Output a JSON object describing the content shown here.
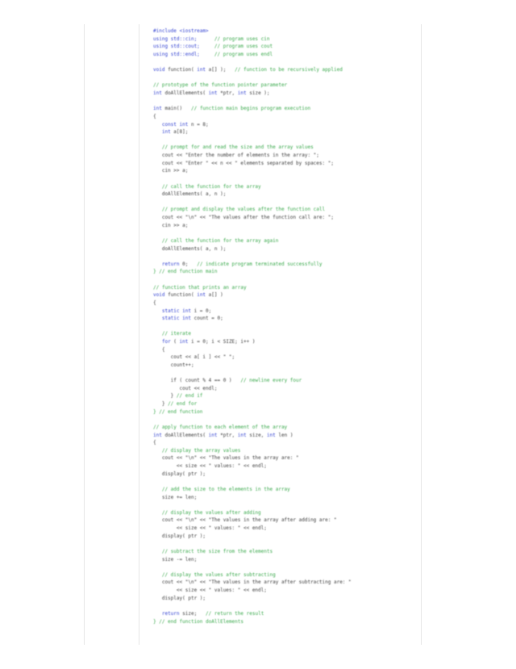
{
  "page": {
    "lines": [
      [
        {
          "t": "#include <iostream>",
          "c": "kw"
        }
      ],
      [
        {
          "t": "using std::cin;",
          "c": "kw"
        },
        {
          "t": "      // program uses cin",
          "c": "cm"
        }
      ],
      [
        {
          "t": "using std::cout;",
          "c": "kw"
        },
        {
          "t": "     // program uses cout",
          "c": "cm"
        }
      ],
      [
        {
          "t": "using std::endl;",
          "c": "kw"
        },
        {
          "t": "     // program uses endl",
          "c": "cm"
        }
      ],
      [
        {
          "t": "",
          "c": "tx"
        }
      ],
      [
        {
          "t": "void",
          "c": "kw"
        },
        {
          "t": " function( ",
          "c": "tx"
        },
        {
          "t": "int",
          "c": "kw"
        },
        {
          "t": " a[] );",
          "c": "tx"
        },
        {
          "t": "   // function to be recursively applied",
          "c": "cm"
        }
      ],
      [
        {
          "t": "",
          "c": "tx"
        }
      ],
      [
        {
          "t": "// prototype of the function pointer parameter",
          "c": "cm"
        }
      ],
      [
        {
          "t": "int",
          "c": "kw"
        },
        {
          "t": " doAllElements( ",
          "c": "tx"
        },
        {
          "t": "int",
          "c": "kw"
        },
        {
          "t": " *ptr, ",
          "c": "tx"
        },
        {
          "t": "int",
          "c": "kw"
        },
        {
          "t": " size );",
          "c": "tx"
        }
      ],
      [
        {
          "t": "",
          "c": "tx"
        }
      ],
      [
        {
          "t": "int",
          "c": "kw"
        },
        {
          "t": " main()",
          "c": "tx"
        },
        {
          "t": "   // function main begins program execution",
          "c": "cm"
        }
      ],
      [
        {
          "t": "{",
          "c": "tx"
        }
      ],
      [
        {
          "t": "   ",
          "c": "tx"
        },
        {
          "t": "const int",
          "c": "kw"
        },
        {
          "t": " n = 8;",
          "c": "tx"
        }
      ],
      [
        {
          "t": "   ",
          "c": "tx"
        },
        {
          "t": "int",
          "c": "kw"
        },
        {
          "t": " a[8];",
          "c": "tx"
        }
      ],
      [
        {
          "t": "",
          "c": "tx"
        }
      ],
      [
        {
          "t": "   // prompt for and read the size and the array values",
          "c": "cm"
        }
      ],
      [
        {
          "t": "   cout << \"Enter the number of elements in the array: \";",
          "c": "tx"
        }
      ],
      [
        {
          "t": "   cout << \"Enter \" << n << \" elements separated by spaces: \";",
          "c": "tx"
        }
      ],
      [
        {
          "t": "   cin >> a;",
          "c": "tx"
        }
      ],
      [
        {
          "t": "",
          "c": "tx"
        }
      ],
      [
        {
          "t": "   // call the function for the array",
          "c": "cm"
        }
      ],
      [
        {
          "t": "   doAllElements( a, n );",
          "c": "tx"
        }
      ],
      [
        {
          "t": "",
          "c": "tx"
        }
      ],
      [
        {
          "t": "   // prompt and display the values after the function call",
          "c": "cm"
        }
      ],
      [
        {
          "t": "   cout << \"\\n\" << \"The values after the function call are: \";",
          "c": "tx"
        }
      ],
      [
        {
          "t": "   cin >> a;",
          "c": "tx"
        }
      ],
      [
        {
          "t": "",
          "c": "tx"
        }
      ],
      [
        {
          "t": "   // call the function for the array again",
          "c": "cm"
        }
      ],
      [
        {
          "t": "   doAllElements( a, n );",
          "c": "tx"
        }
      ],
      [
        {
          "t": "",
          "c": "tx"
        }
      ],
      [
        {
          "t": "   ",
          "c": "tx"
        },
        {
          "t": "return",
          "c": "kw"
        },
        {
          "t": " 0;",
          "c": "tx"
        },
        {
          "t": "   // indicate program terminated successfully",
          "c": "cm"
        }
      ],
      [
        {
          "t": "} // end function main",
          "c": "cm"
        }
      ],
      [
        {
          "t": "",
          "c": "tx"
        }
      ],
      [
        {
          "t": "// function that prints an array",
          "c": "cm"
        }
      ],
      [
        {
          "t": "void",
          "c": "kw"
        },
        {
          "t": " function( ",
          "c": "tx"
        },
        {
          "t": "int",
          "c": "kw"
        },
        {
          "t": " a[] )",
          "c": "tx"
        }
      ],
      [
        {
          "t": "{",
          "c": "tx"
        }
      ],
      [
        {
          "t": "   ",
          "c": "tx"
        },
        {
          "t": "static int",
          "c": "kw"
        },
        {
          "t": " i = 0;",
          "c": "tx"
        }
      ],
      [
        {
          "t": "   ",
          "c": "tx"
        },
        {
          "t": "static int",
          "c": "kw"
        },
        {
          "t": " count = 0;",
          "c": "tx"
        }
      ],
      [
        {
          "t": "",
          "c": "tx"
        }
      ],
      [
        {
          "t": "   // iterate",
          "c": "cm"
        }
      ],
      [
        {
          "t": "   ",
          "c": "tx"
        },
        {
          "t": "for",
          "c": "kw"
        },
        {
          "t": " ( ",
          "c": "tx"
        },
        {
          "t": "int",
          "c": "kw"
        },
        {
          "t": " i = 0; i < SIZE; i++ )",
          "c": "tx"
        }
      ],
      [
        {
          "t": "   {",
          "c": "tx"
        }
      ],
      [
        {
          "t": "      cout << a[ i ] << \" \";",
          "c": "tx"
        }
      ],
      [
        {
          "t": "      count++;",
          "c": "tx"
        }
      ],
      [
        {
          "t": "",
          "c": "tx"
        }
      ],
      [
        {
          "t": "      if ( count % 4 == 0 )",
          "c": "tx"
        },
        {
          "t": "   // newline every four",
          "c": "cm"
        }
      ],
      [
        {
          "t": "         cout << endl;",
          "c": "tx"
        }
      ],
      [
        {
          "t": "      }",
          "c": "tx"
        },
        {
          "t": " // end if",
          "c": "cm"
        }
      ],
      [
        {
          "t": "   }",
          "c": "tx"
        },
        {
          "t": " // end for",
          "c": "cm"
        }
      ],
      [
        {
          "t": "} // end function",
          "c": "cm"
        }
      ],
      [
        {
          "t": "",
          "c": "tx"
        }
      ],
      [
        {
          "t": "// apply function to each element of the array",
          "c": "cm"
        }
      ],
      [
        {
          "t": "int",
          "c": "kw"
        },
        {
          "t": " doAllElements( ",
          "c": "tx"
        },
        {
          "t": "int",
          "c": "kw"
        },
        {
          "t": " *ptr, ",
          "c": "tx"
        },
        {
          "t": "int",
          "c": "kw"
        },
        {
          "t": " size, ",
          "c": "tx"
        },
        {
          "t": "int",
          "c": "kw"
        },
        {
          "t": " len )",
          "c": "tx"
        }
      ],
      [
        {
          "t": "{",
          "c": "tx"
        }
      ],
      [
        {
          "t": "   // display the array values",
          "c": "cm"
        }
      ],
      [
        {
          "t": "   cout << \"\\n\" << \"The values in the array are: \"",
          "c": "tx"
        }
      ],
      [
        {
          "t": "        << size << \" values: \" << endl;",
          "c": "tx"
        }
      ],
      [
        {
          "t": "   display( ptr );",
          "c": "tx"
        }
      ],
      [
        {
          "t": "",
          "c": "tx"
        }
      ],
      [
        {
          "t": "   // add the size to the elements in the array",
          "c": "cm"
        }
      ],
      [
        {
          "t": "   size += len;",
          "c": "tx"
        }
      ],
      [
        {
          "t": "",
          "c": "tx"
        }
      ],
      [
        {
          "t": "   // display the values after adding",
          "c": "cm"
        }
      ],
      [
        {
          "t": "   cout << \"\\n\" << \"The values in the array after adding are: \"",
          "c": "tx"
        }
      ],
      [
        {
          "t": "        << size << \" values: \" << endl;",
          "c": "tx"
        }
      ],
      [
        {
          "t": "   display( ptr );",
          "c": "tx"
        }
      ],
      [
        {
          "t": "",
          "c": "tx"
        }
      ],
      [
        {
          "t": "   // subtract the size from the elements",
          "c": "cm"
        }
      ],
      [
        {
          "t": "   size -= len;",
          "c": "tx"
        }
      ],
      [
        {
          "t": "",
          "c": "tx"
        }
      ],
      [
        {
          "t": "   // display the values after subtracting",
          "c": "cm"
        }
      ],
      [
        {
          "t": "   cout << \"\\n\" << \"The values in the array after subtracting are: \"",
          "c": "tx"
        }
      ],
      [
        {
          "t": "        << size << \" values: \" << endl;",
          "c": "tx"
        }
      ],
      [
        {
          "t": "   display( ptr );",
          "c": "tx"
        }
      ],
      [
        {
          "t": "",
          "c": "tx"
        }
      ],
      [
        {
          "t": "   ",
          "c": "tx"
        },
        {
          "t": "return",
          "c": "kw"
        },
        {
          "t": " size;",
          "c": "tx"
        },
        {
          "t": "   // return the result",
          "c": "cm"
        }
      ],
      [
        {
          "t": "} // end function doAllElements",
          "c": "cm"
        }
      ]
    ]
  }
}
